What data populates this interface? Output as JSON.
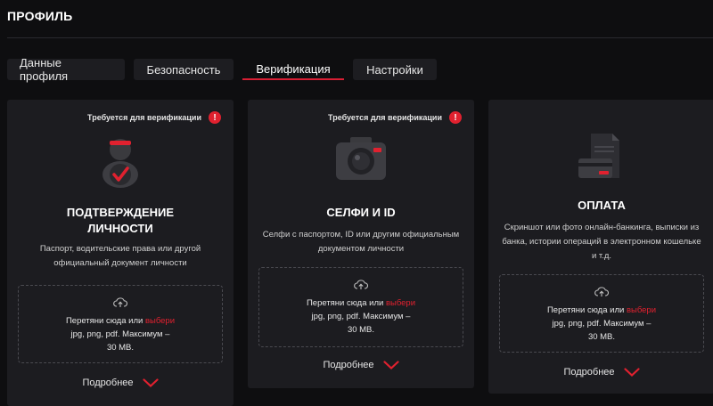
{
  "header": {
    "title": "ПРОФИЛЬ"
  },
  "tabs": [
    {
      "label": "Данные профиля"
    },
    {
      "label": "Безопасность"
    },
    {
      "label": "Верификация"
    },
    {
      "label": "Настройки"
    }
  ],
  "active_tab": "Верификация",
  "colors": {
    "accent": "#e0212f",
    "background": "#0e0e10",
    "card": "#1c1c20"
  },
  "cards": [
    {
      "required": "Требуется для верификации",
      "badge": "!",
      "icon": "verified-user-icon",
      "title_line1": "ПОДТВЕРЖДЕНИЕ",
      "title_line2": "ЛИЧНОСТИ",
      "desc_line1": "Паспорт, водительские права или другой",
      "desc_line2": "официальный документ личности",
      "drop_text": "Перетяни сюда или ",
      "drop_link": "выбери",
      "drop_formats": "jpg, png, pdf. Максимум –",
      "drop_size": "30 MB.",
      "more": "Подробнее"
    },
    {
      "required": "Требуется для верификации",
      "badge": "!",
      "icon": "camera-icon",
      "title_line1": "СЕЛФИ И ID",
      "desc_line1": "Селфи с паспортом, ID или другим официальным",
      "desc_line2": "документом личности",
      "drop_text": "Перетяни сюда или ",
      "drop_link": "выбери",
      "drop_formats": "jpg, png, pdf. Максимум –",
      "drop_size": "30 MB.",
      "more": "Подробнее"
    },
    {
      "icon": "payment-document-icon",
      "title_line1": "ОПЛАТА",
      "desc_line1": "Скриншот или фото онлайн-банкинга, выписки из",
      "desc_line2": "банка, истории операций в электронном кошельке",
      "desc_line3": "и т.д.",
      "drop_text": "Перетяни сюда или ",
      "drop_link": "выбери",
      "drop_formats": "jpg, png, pdf. Максимум –",
      "drop_size": "30 MB.",
      "more": "Подробнее"
    }
  ]
}
